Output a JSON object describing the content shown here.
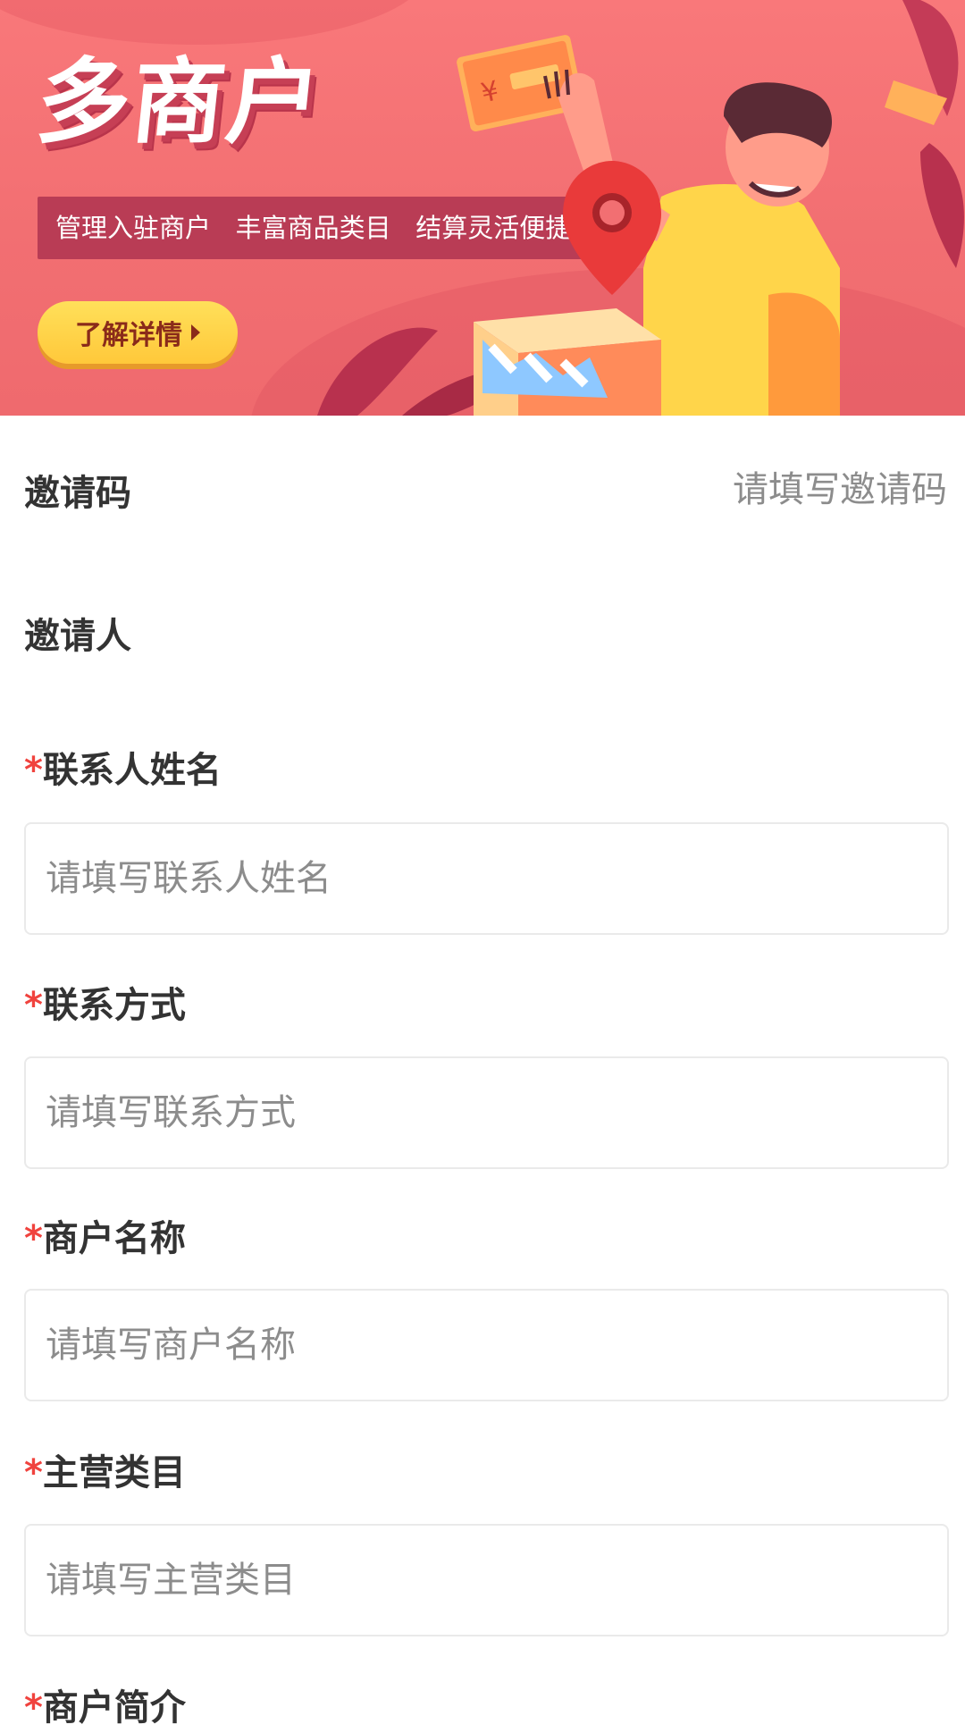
{
  "banner": {
    "title": "多商户",
    "tagline": "管理入驻商户   丰富商品类目   结算灵活便捷",
    "cta_label": "了解详情"
  },
  "invite_code": {
    "label": "邀请码",
    "placeholder": "请填写邀请码"
  },
  "inviter": {
    "label": "邀请人",
    "value": ""
  },
  "fields": [
    {
      "required_mark": "*",
      "label": "联系人姓名",
      "placeholder": "请填写联系人姓名"
    },
    {
      "required_mark": "*",
      "label": "联系方式",
      "placeholder": "请填写联系方式"
    },
    {
      "required_mark": "*",
      "label": "商户名称",
      "placeholder": "请填写商户名称"
    },
    {
      "required_mark": "*",
      "label": "主营类目",
      "placeholder": "请填写主营类目"
    },
    {
      "required_mark": "*",
      "label": "商户简介"
    }
  ],
  "colors": {
    "banner_bg": "#f57375",
    "required_star": "#f0433e",
    "label_text": "#333333",
    "placeholder_text": "#8c8c8c",
    "cta_yellow": "#ffd447"
  }
}
